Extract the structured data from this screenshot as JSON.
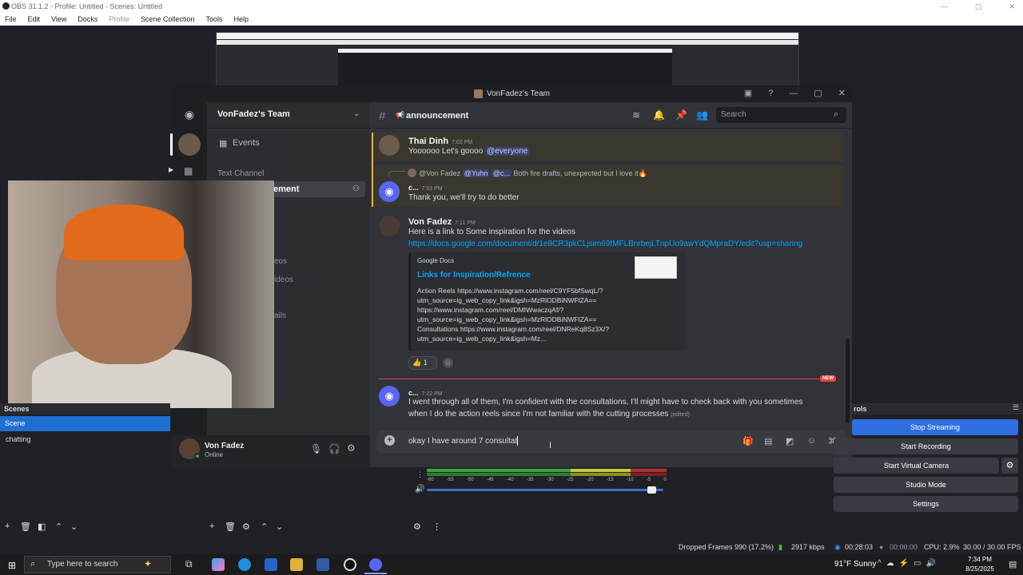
{
  "obs": {
    "window_title": "OBS 31.1.2 - Profile: Untitled - Scenes: Untitled",
    "menu": [
      "File",
      "Edit",
      "View",
      "Docks",
      "Profile",
      "Scene Collection",
      "Tools",
      "Help"
    ],
    "scenes_header": "Scenes",
    "scenes": [
      "Scene",
      "chatting"
    ],
    "controls_header": "rols",
    "controls": [
      "Stop Streaming",
      "Start Recording",
      "Start Virtual Camera",
      "Studio Mode",
      "Settings"
    ],
    "mixer_scale": [
      "-60",
      "-55",
      "-50",
      "-45",
      "-40",
      "-35",
      "-30",
      "-25",
      "-20",
      "-15",
      "-10",
      "-5",
      "0"
    ],
    "volume_level": 0.97,
    "status": {
      "dropped_frames": "Dropped Frames 990 (17.2%)",
      "bitrate": "2917 kbps",
      "stream_time": "00:28:03",
      "rec_time": "00:00:00",
      "cpu": "CPU: 2.9%",
      "fps": "30.00 / 30.00 FPS"
    }
  },
  "discord": {
    "window_title": "VonFadez's Team",
    "server_name": "VonFadez's Team",
    "events_label": "Events",
    "text_channel_label": "Text Channel",
    "active_channel_fragment": "ement",
    "clipped_channels": [
      "eos",
      "ideos",
      "ails"
    ],
    "channel_name": "announcement",
    "search_placeholder": "Search",
    "user": {
      "name": "Von Fadez",
      "status": "Online"
    },
    "messages": [
      {
        "author": "Thai Dinh",
        "time": "7:02 PM",
        "text": "Yoooooo Let's goooo",
        "mention": "@everyone"
      },
      {
        "reply_author": "@Von Fadez",
        "reply_mentions": [
          "@Yuhn",
          "@c..."
        ],
        "reply_text": "Both fire drafts, unexpected but I love it",
        "author": "c...",
        "time": "7:03 PM",
        "text": "Thank you, we'll try to do better"
      },
      {
        "author": "Von Fadez",
        "time": "7:11 PM",
        "text": "Here is a link to Some inspiration for the videos",
        "link": "https://docs.google.com/document/d/1e8CR3pkCLjsim69fMFLBnrbejLTnpUo9awYdQMpraDY/edit?usp=sharing"
      },
      {
        "author": "c...",
        "time": "7:22 PM",
        "text_line1": "I went through all of them, I'm confident with the consultations, I'll might have to check back with you sometimes",
        "text_line2": "when I do the action reels since I'm not familiar with the cutting processes",
        "edited": "(edited)"
      }
    ],
    "embed": {
      "provider": "Google Docs",
      "title": "Links for Inspiration/Refrence",
      "lines": [
        "Action Reels https://www.instagram.com/reel/C9YF5bfSwqL/?",
        "utm_source=ig_web_copy_link&igsh=MzRlODBiNWFlZA==",
        "https://www.instagram.com/reel/DMIWwaczqAf/?",
        "utm_source=ig_web_copy_link&igsh=MzRlODBiNWFlZA==",
        "Consultations https://www.instagram.com/reel/DNReKq8Sz3X/?",
        "utm_source=ig_web_copy_link&igsh=Mz..."
      ]
    },
    "reaction": {
      "emoji": "👍",
      "count": "1"
    },
    "new_tag": "NEW",
    "composer_text": "okay I have around 7 consultat"
  },
  "taskbar": {
    "search_placeholder": "Type here to search",
    "weather": "91°F  Sunny",
    "time": "7:34 PM",
    "date": "8/25/2025"
  }
}
